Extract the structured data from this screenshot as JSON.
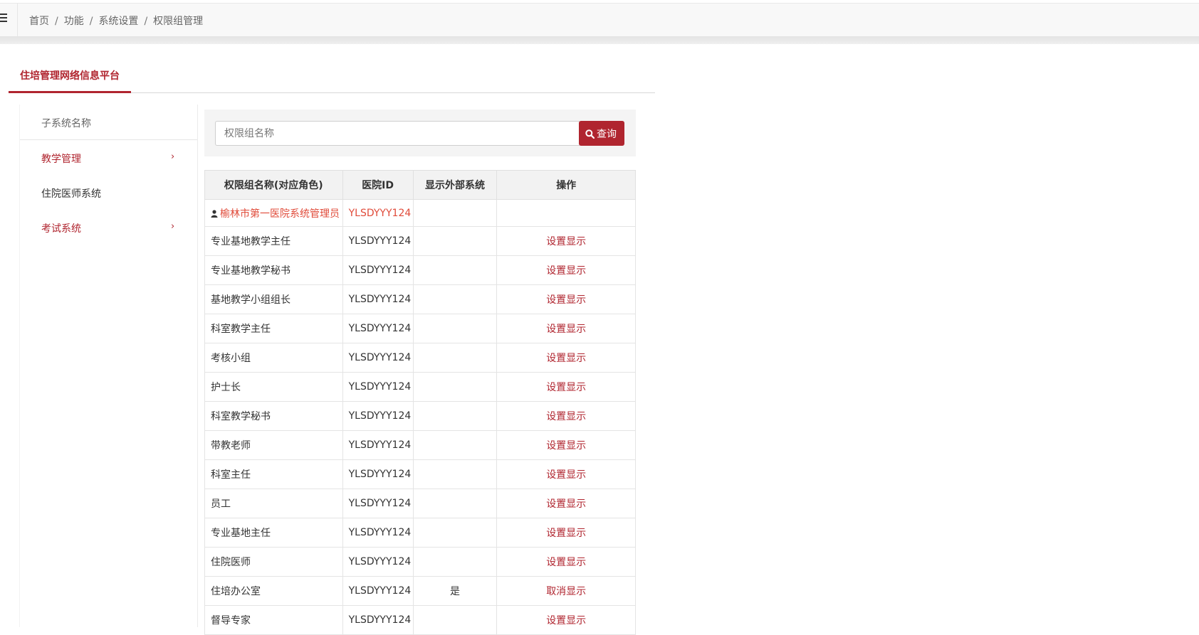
{
  "breadcrumb": [
    "首页",
    "功能",
    "系统设置",
    "权限组管理"
  ],
  "tab": {
    "label": "住培管理网络信息平台"
  },
  "sidebar": {
    "header": "子系统名称",
    "items": [
      {
        "label": "教学管理",
        "has_children": true,
        "active": true
      },
      {
        "label": "住院医师系统",
        "has_children": false,
        "active": false
      },
      {
        "label": "考试系统",
        "has_children": true,
        "active": true
      }
    ]
  },
  "search": {
    "placeholder": "权限组名称",
    "value": "",
    "button_label": "查询"
  },
  "table": {
    "columns": [
      "权限组名称(对应角色)",
      "医院ID",
      "显示外部系统",
      "操作"
    ],
    "admin_row": {
      "name": "榆林市第一医院系统管理员",
      "hospital_id": "YLSDYYY124",
      "external": "",
      "action": ""
    },
    "rows": [
      {
        "name": "专业基地教学主任",
        "hospital_id": "YLSDYYY124",
        "external": "",
        "action": "设置显示"
      },
      {
        "name": "专业基地教学秘书",
        "hospital_id": "YLSDYYY124",
        "external": "",
        "action": "设置显示"
      },
      {
        "name": "基地教学小组组长",
        "hospital_id": "YLSDYYY124",
        "external": "",
        "action": "设置显示"
      },
      {
        "name": "科室教学主任",
        "hospital_id": "YLSDYYY124",
        "external": "",
        "action": "设置显示"
      },
      {
        "name": "考核小组",
        "hospital_id": "YLSDYYY124",
        "external": "",
        "action": "设置显示"
      },
      {
        "name": "护士长",
        "hospital_id": "YLSDYYY124",
        "external": "",
        "action": "设置显示"
      },
      {
        "name": "科室教学秘书",
        "hospital_id": "YLSDYYY124",
        "external": "",
        "action": "设置显示"
      },
      {
        "name": "带教老师",
        "hospital_id": "YLSDYYY124",
        "external": "",
        "action": "设置显示"
      },
      {
        "name": "科室主任",
        "hospital_id": "YLSDYYY124",
        "external": "",
        "action": "设置显示"
      },
      {
        "name": "员工",
        "hospital_id": "YLSDYYY124",
        "external": "",
        "action": "设置显示"
      },
      {
        "name": "专业基地主任",
        "hospital_id": "YLSDYYY124",
        "external": "",
        "action": "设置显示"
      },
      {
        "name": "住院医师",
        "hospital_id": "YLSDYYY124",
        "external": "",
        "action": "设置显示"
      },
      {
        "name": "住培办公室",
        "hospital_id": "YLSDYYY124",
        "external": "是",
        "action": "取消显示"
      },
      {
        "name": "督导专家",
        "hospital_id": "YLSDYYY124",
        "external": "",
        "action": "设置显示"
      }
    ]
  },
  "colors": {
    "accent": "#b0252f",
    "admin_text": "#e04b3a"
  }
}
